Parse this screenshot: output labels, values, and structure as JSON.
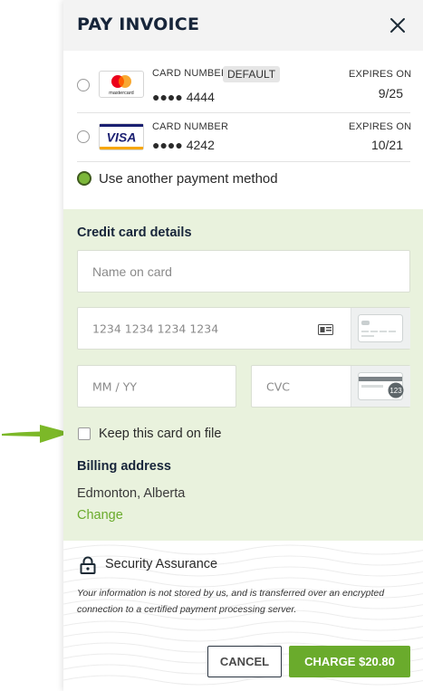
{
  "header": {
    "title": "PAY INVOICE"
  },
  "saved_cards": [
    {
      "brand": "mastercard",
      "brand_label": "mastercard",
      "number_label": "CARD NUMBER",
      "badge": "DEFAULT",
      "number": "●●●● 4444",
      "expires_label": "EXPIRES ON",
      "expires": "9/25",
      "selected": false
    },
    {
      "brand": "visa",
      "brand_label": "VISA",
      "number_label": "CARD NUMBER",
      "number": "●●●● 4242",
      "expires_label": "EXPIRES ON",
      "expires": "10/21",
      "selected": false
    }
  ],
  "other_method": {
    "label": "Use another payment method",
    "selected": true
  },
  "credit_card": {
    "title": "Credit card details",
    "name_placeholder": "Name on card",
    "number_placeholder": "1234 1234 1234 1234",
    "expiry_placeholder": "MM / YY",
    "cvc_placeholder": "CVC",
    "cvc_hint": "123"
  },
  "keep_on_file": {
    "label": "Keep this card on file",
    "checked": false
  },
  "billing": {
    "title": "Billing address",
    "value": "Edmonton, Alberta",
    "change_label": "Change"
  },
  "security": {
    "title": "Security Assurance",
    "text": "Your information is not stored by us, and is transferred over an encrypted connection to a certified payment processing server."
  },
  "actions": {
    "cancel_label": "CANCEL",
    "charge_label": "CHARGE $20.80"
  },
  "colors": {
    "accent_green": "#6aab2c",
    "details_bg": "#e9f2dd",
    "header_bg": "#f3f3f3",
    "pointer_arrow": "#7cb828"
  }
}
